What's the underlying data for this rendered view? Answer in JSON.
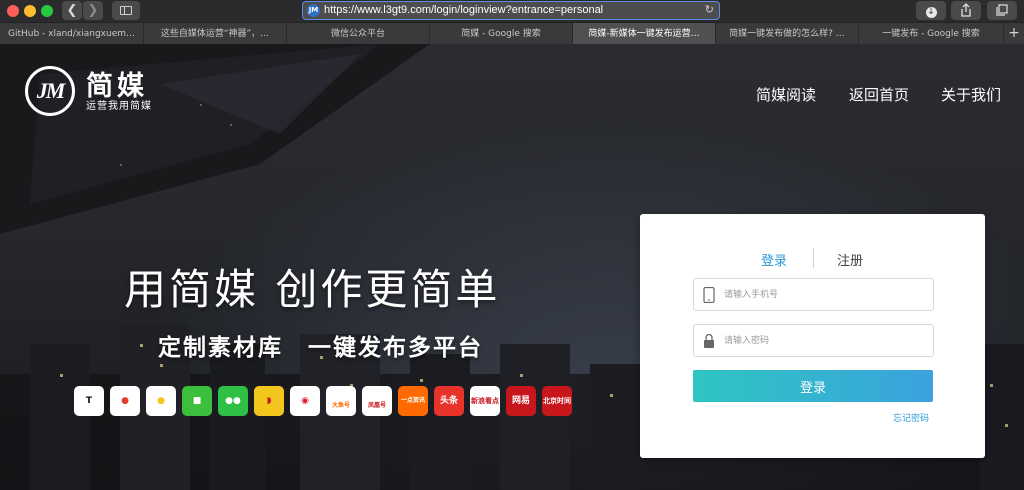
{
  "browser": {
    "url": "https://www.l3gt9.com/login/loginview?entrance=personal",
    "tabs": [
      {
        "label": "GitHub - xland/xiangxuem…",
        "active": false
      },
      {
        "label": "这些自媒体运营“神器”，…",
        "active": false
      },
      {
        "label": "微信公众平台",
        "active": false
      },
      {
        "label": "简媒 - Google 搜索",
        "active": false
      },
      {
        "label": "简媒-新媒体一键发布运营…",
        "active": true
      },
      {
        "label": "简媒一键发布做的怎么样? …",
        "active": false
      },
      {
        "label": "一键发布 - Google 搜索",
        "active": false
      }
    ],
    "icons": {
      "back": "chevron-left-icon",
      "forward": "chevron-right-icon",
      "sidebar": "sidebar-icon",
      "reload": "reload-icon",
      "download": "download-icon",
      "share": "share-icon",
      "tabs_overview": "tabs-icon",
      "new_tab": "plus-icon"
    }
  },
  "site": {
    "logo_mark": "JM",
    "logo_name": "简媒",
    "logo_slogan": "运营我用简媒",
    "nav": {
      "read": "简媒阅读",
      "home": "返回首页",
      "about": "关于我们"
    },
    "hero_title": "用简媒 创作更简单",
    "hero_subtitle": "定制素材库　一键发布多平台",
    "platforms": [
      {
        "label": "",
        "color": "#ffffff",
        "icon": "toutiao-T-icon"
      },
      {
        "label": "",
        "color": "#e63c2f",
        "icon": "ucloud-icon"
      },
      {
        "label": "",
        "color": "#f5c518",
        "icon": "qq-penguin-icon"
      },
      {
        "label": "",
        "color": "#3cbf3c",
        "icon": "iqiyi-icon"
      },
      {
        "label": "",
        "color": "#2fbf45",
        "icon": "wechat-icon"
      },
      {
        "label": "",
        "color": "#f2c61c",
        "icon": "sohu-icon"
      },
      {
        "label": "",
        "color": "#ffffff",
        "icon": "weibo-icon"
      },
      {
        "label": "大鱼号",
        "color": "#ffffff",
        "icon": "dayu-icon"
      },
      {
        "label": "凤凰号",
        "color": "#ffffff",
        "icon": "ifeng-icon"
      },
      {
        "label": "一点资讯",
        "color": "#ff6a00",
        "icon": "yidian-icon"
      },
      {
        "label": "头条",
        "color": "#e8332a",
        "icon": "toutiao-icon"
      },
      {
        "label": "新浪看点",
        "color": "#ffffff",
        "icon": "sina-kandian-icon"
      },
      {
        "label": "网易",
        "color": "#c8161d",
        "icon": "netease-icon"
      },
      {
        "label": "北京时间",
        "color": "#c8161d",
        "icon": "btime-icon"
      }
    ],
    "login": {
      "tab_login": "登录",
      "tab_register": "注册",
      "phone_placeholder": "请输入手机号",
      "password_placeholder": "请输入密码",
      "submit": "登录",
      "forgot": "忘记密码",
      "accent_color": "#2e9bd9"
    }
  }
}
